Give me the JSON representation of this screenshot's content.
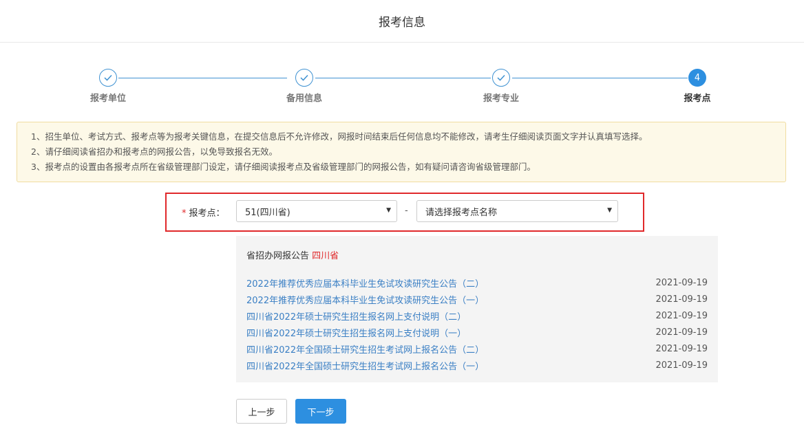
{
  "header": {
    "title": "报考信息"
  },
  "steps": [
    {
      "label": "报考单位",
      "state": "done"
    },
    {
      "label": "备用信息",
      "state": "done"
    },
    {
      "label": "报考专业",
      "state": "done"
    },
    {
      "label": "报考点",
      "state": "active",
      "number": "4"
    }
  ],
  "notice": [
    "1、招生单位、考试方式、报考点等为报考关键信息，在提交信息后不允许修改，网报时间结束后任何信息均不能修改，请考生仔细阅读页面文字并认真填写选择。",
    "2、请仔细阅读省招办和报考点的网报公告，以免导致报名无效。",
    "3、报考点的设置由各报考点所在省级管理部门设定，请仔细阅读报考点及省级管理部门的网报公告，如有疑问请咨询省级管理部门。"
  ],
  "form": {
    "required_mark": "*",
    "label": "报考点：",
    "province_value": "51(四川省)",
    "dash": "-",
    "site_placeholder": "请选择报考点名称",
    "arrow": "▼"
  },
  "announce": {
    "title": "省招办网报公告",
    "province": "四川省",
    "items": [
      {
        "title": "2022年推荐优秀应届本科毕业生免试攻读研究生公告（二）",
        "date": "2021-09-19"
      },
      {
        "title": "2022年推荐优秀应届本科毕业生免试攻读研究生公告（一）",
        "date": "2021-09-19"
      },
      {
        "title": "四川省2022年硕士研究生招生报名网上支付说明（二）",
        "date": "2021-09-19"
      },
      {
        "title": "四川省2022年硕士研究生招生报名网上支付说明（一）",
        "date": "2021-09-19"
      },
      {
        "title": "四川省2022年全国硕士研究生招生考试网上报名公告（二）",
        "date": "2021-09-19"
      },
      {
        "title": "四川省2022年全国硕士研究生招生考试网上报名公告（一）",
        "date": "2021-09-19"
      }
    ]
  },
  "buttons": {
    "prev": "上一步",
    "next": "下一步"
  },
  "colors": {
    "accent": "#2d8fe0",
    "highlight_border": "#e0282a",
    "notice_bg": "#fdf9e8",
    "link": "#3a7fc4"
  }
}
